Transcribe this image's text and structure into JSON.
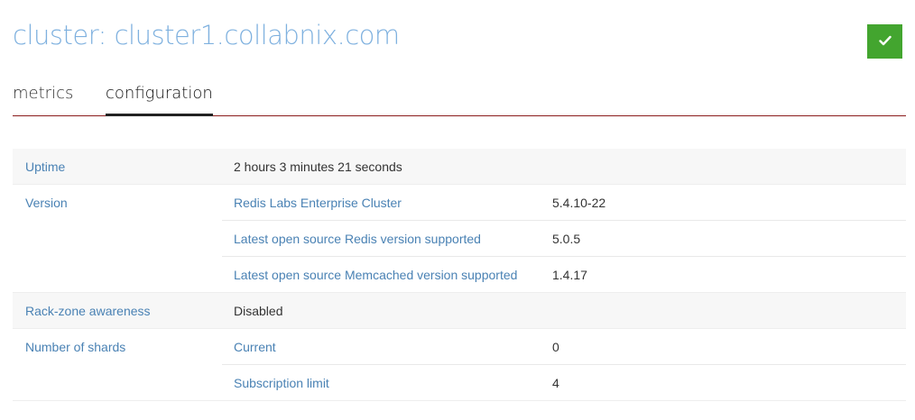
{
  "header": {
    "title": "cluster: cluster1.collabnix.com",
    "status_icon": "check-icon",
    "status_color": "#43a52f"
  },
  "tabs": [
    {
      "label": "metrics",
      "active": false
    },
    {
      "label": "configuration",
      "active": true
    }
  ],
  "config": {
    "uptime": {
      "label": "Uptime",
      "value": "2 hours 3 minutes 21 seconds"
    },
    "version": {
      "label": "Version",
      "items": [
        {
          "label": "Redis Labs Enterprise Cluster",
          "value": "5.4.10-22"
        },
        {
          "label": "Latest open source Redis version supported",
          "value": "5.0.5"
        },
        {
          "label": "Latest open source Memcached version supported",
          "value": "1.4.17"
        }
      ]
    },
    "rack_zone": {
      "label": "Rack-zone awareness",
      "value": "Disabled"
    },
    "shards": {
      "label": "Number of shards",
      "items": [
        {
          "label": "Current",
          "value": "0"
        },
        {
          "label": "Subscription limit",
          "value": "4"
        }
      ]
    }
  },
  "colors": {
    "title": "#7fb1df",
    "label": "#4a82b4",
    "tab_underline": "#8a1c1c",
    "row_shade": "#f7f7f7"
  }
}
